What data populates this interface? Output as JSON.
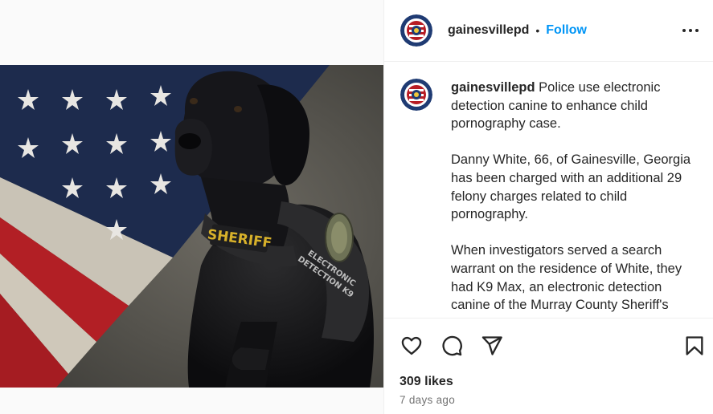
{
  "post": {
    "username": "gainesvillepd",
    "separator": "•",
    "follow_label": "Follow",
    "more_icon": "more-horizontal-icon",
    "image_badge_text": "SHERIFF",
    "image_vest_text_line1": "ELECTRONIC",
    "image_vest_text_line2": "DETECTION K9",
    "caption": {
      "username": "gainesvillepd",
      "paragraph1": "Police use electronic detection canine to enhance child pornography case.",
      "paragraph2": "Danny White, 66, of Gainesville, Georgia has been charged with an additional 29 felony charges related to child pornography.",
      "paragraph3": "When investigators served a search warrant on the residence of White, they had K9 Max, an electronic detection canine of the Murray County Sheriff's Office, assist with"
    },
    "likes_label": "309 likes",
    "time_ago": "7 days ago"
  },
  "icons": {
    "like": "heart-icon",
    "comment": "comment-icon",
    "share": "share-icon",
    "save": "bookmark-icon"
  }
}
